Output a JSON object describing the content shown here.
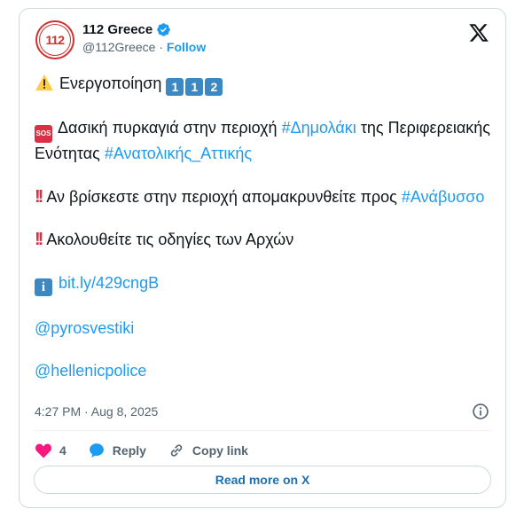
{
  "author": {
    "name": "112 Greece",
    "handle": "@112Greece",
    "separator": "·",
    "follow_label": "Follow",
    "avatar_text": "112"
  },
  "post": {
    "line1_text": "Ενεργοποίηση",
    "line1_digits": [
      "1",
      "1",
      "2"
    ],
    "sos_label": "SOS",
    "para2_text_a": "Δασική πυρκαγιά στην περιοχή",
    "para2_hashtag1": "#Δημολάκι",
    "para2_text_b": "της Περιφερειακής Ενότητας",
    "para2_hashtag2": "#Ανατολικής_Αττικής",
    "para3_text": "Αν βρίσκεστε στην περιοχή απομακρυνθείτε προς",
    "para3_hashtag": "#Ανάβυσσο",
    "para4_text": "Ακολουθείτε τις οδηγίες των Αρχών",
    "info_glyph": "i",
    "link": "bit.ly/429cngB",
    "mention1": "@pyrosvestiki",
    "mention2": "@hellenicpolice"
  },
  "timestamp": "4:27 PM · Aug 8, 2025",
  "actions": {
    "like_count": "4",
    "reply_label": "Reply",
    "copy_label": "Copy link"
  },
  "read_more_label": "Read more on X",
  "colors": {
    "accent": "#1d9bf0",
    "like": "#f91880",
    "alert": "#dd2e44"
  }
}
